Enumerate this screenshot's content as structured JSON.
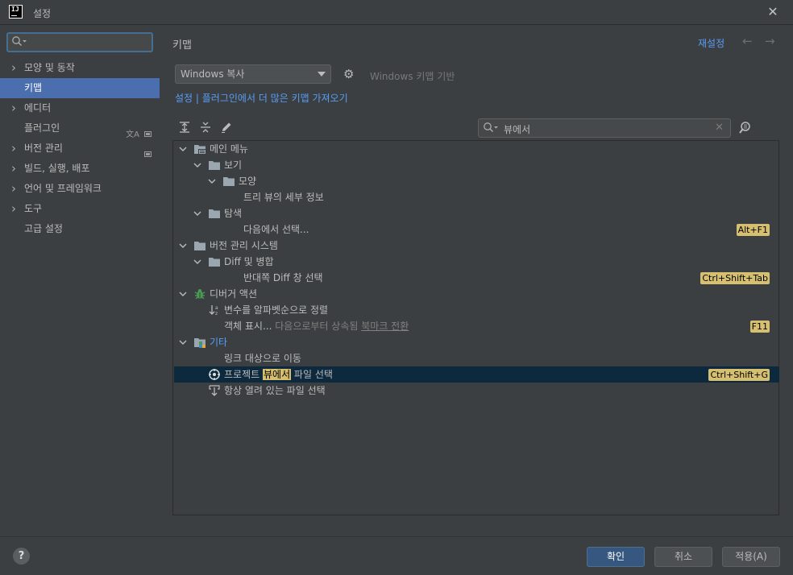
{
  "window": {
    "title": "설정",
    "close_label": "✕"
  },
  "sidebar": {
    "search_placeholder": "",
    "items": [
      {
        "label": "모양 및 동작",
        "expandable": true
      },
      {
        "label": "키맵",
        "expandable": false,
        "selected": true
      },
      {
        "label": "에디터",
        "expandable": true
      },
      {
        "label": "플러그인",
        "expandable": false,
        "marks": [
          "translate-icon",
          "settings-badge-icon"
        ]
      },
      {
        "label": "버전 관리",
        "expandable": true,
        "marks": [
          "settings-badge-icon"
        ]
      },
      {
        "label": "빌드, 실행, 배포",
        "expandable": true
      },
      {
        "label": "언어 및 프레임워크",
        "expandable": true
      },
      {
        "label": "도구",
        "expandable": true
      },
      {
        "label": "고급 설정",
        "expandable": false
      }
    ]
  },
  "header": {
    "title": "키맵",
    "reset_label": "재설정"
  },
  "keymap": {
    "selected": "Windows 복사",
    "based_on": "Windows 키맵 기반",
    "link_settings": "설정",
    "link_separator": " | ",
    "link_plugins": "플러그인에서 더 많은 키맵 가져오기"
  },
  "filter": {
    "value": "뷰에서"
  },
  "tree": [
    {
      "depth": 0,
      "expanded": true,
      "icon": "menu-folder-icon",
      "text": "메인 메뉴"
    },
    {
      "depth": 1,
      "expanded": true,
      "icon": "folder-icon",
      "text": "보기"
    },
    {
      "depth": 2,
      "expanded": true,
      "icon": "folder-icon",
      "text": "모양"
    },
    {
      "depth": 3,
      "icon": "",
      "text": "트리 뷰의 세부 정보"
    },
    {
      "depth": 1,
      "expanded": true,
      "icon": "folder-icon",
      "text": "탐색"
    },
    {
      "depth": 2,
      "icon": "",
      "text": "다음에서 선택...",
      "shortcut": "Alt+F1"
    },
    {
      "depth": 0,
      "expanded": true,
      "icon": "folder-icon",
      "text": "버전 관리 시스템"
    },
    {
      "depth": 1,
      "expanded": true,
      "icon": "folder-icon",
      "text": "Diff 및 병합"
    },
    {
      "depth": 2,
      "icon": "",
      "text": "반대쪽 Diff 창 선택",
      "shortcut": "Ctrl+Shift+Tab"
    },
    {
      "depth": 0,
      "expanded": true,
      "icon": "debugger-icon",
      "text": "디버거 액션"
    },
    {
      "depth": 1,
      "icon": "sort-icon",
      "text": "변수를 알파벳순으로 정렬"
    },
    {
      "depth": 1,
      "icon": "",
      "text": "객체 표시...",
      "gray": " 다음으로부터 상속됨 ",
      "underline": "북마크 전환",
      "shortcut": "F11"
    },
    {
      "depth": 0,
      "expanded": true,
      "icon": "other-icon",
      "text": "기타",
      "blue": true
    },
    {
      "depth": 1,
      "icon": "",
      "text": "링크 대상으로 이동"
    },
    {
      "depth": 1,
      "icon": "locate-icon",
      "pre": "프로젝트 ",
      "hl": "뷰에서",
      "post": " 파일 선택",
      "shortcut": "Ctrl+Shift+G",
      "selected": true
    },
    {
      "depth": 1,
      "icon": "autoscroll-icon",
      "text": "항상 열려 있는 파일 선택"
    }
  ],
  "footer": {
    "help": "?",
    "ok": "확인",
    "cancel": "취소",
    "apply": "적용(A)"
  }
}
